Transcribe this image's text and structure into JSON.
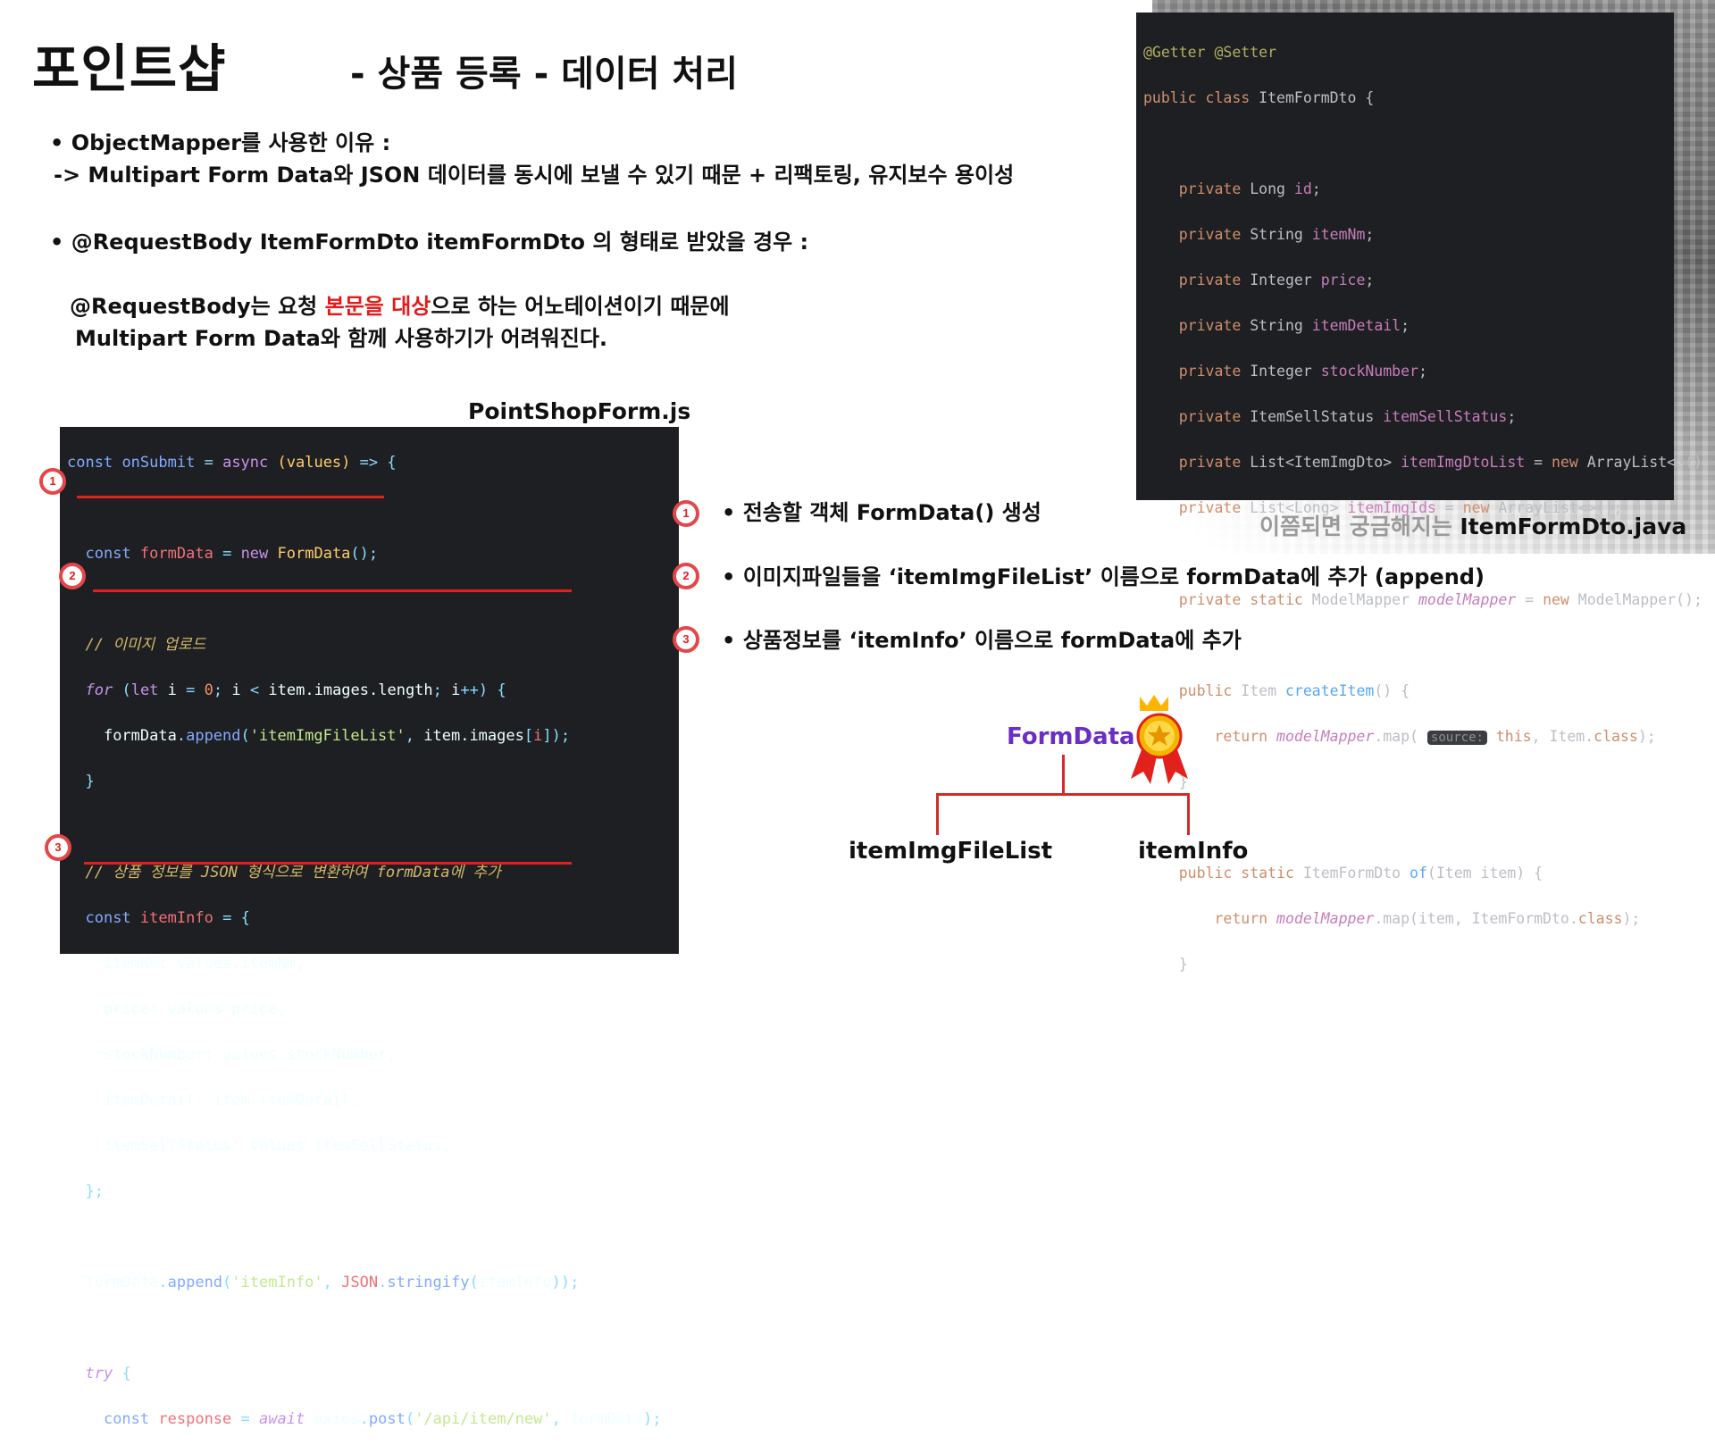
{
  "header": {
    "brand": "포인트샵",
    "subtitle": "- 상품 등록 - 데이터 처리"
  },
  "bullets": {
    "b1_title": "• ObjectMapper를 사용한 이유 :",
    "b1_detail": "-> Multipart Form Data와 JSON 데이터를 동시에 보낼 수 있기 때문 + 리팩토링, 유지보수 용이성",
    "b2_title": "• @RequestBody ItemFormDto itemFormDto 의 형태로 받았을 경우 :",
    "b2_line1_pre": "@RequestBody는 요청 ",
    "b2_line1_red": "본문을 대상",
    "b2_line1_post": "으로 하는 어노테이션이기 때문에",
    "b2_line2": "Multipart Form Data와 함께 사용하기가 어려워진다."
  },
  "js_panel": {
    "filename": "PointShopForm.js"
  },
  "java_panel": {
    "caption_pre": "이쯤되면 궁금해지는 ",
    "caption_file": "ItemFormDto.java"
  },
  "steps": [
    {
      "num": "1",
      "text": "• 전송할 객체 FormData() 생성"
    },
    {
      "num": "2",
      "text": "• 이미지파일들을 ‘itemImgFileList’ 이름으로 formData에 추가 (append)"
    },
    {
      "num": "3",
      "text": "• 상품정보를 ‘itemInfo’ 이름으로 formData에 추가"
    }
  ],
  "diagram": {
    "root": "FormData",
    "child_left": "itemImgFileList",
    "child_right": "itemInfo"
  },
  "colors": {
    "accent_red": "#e3211c",
    "formdata_purple": "#6a2fc2",
    "code_bg": "#1e1f22"
  }
}
